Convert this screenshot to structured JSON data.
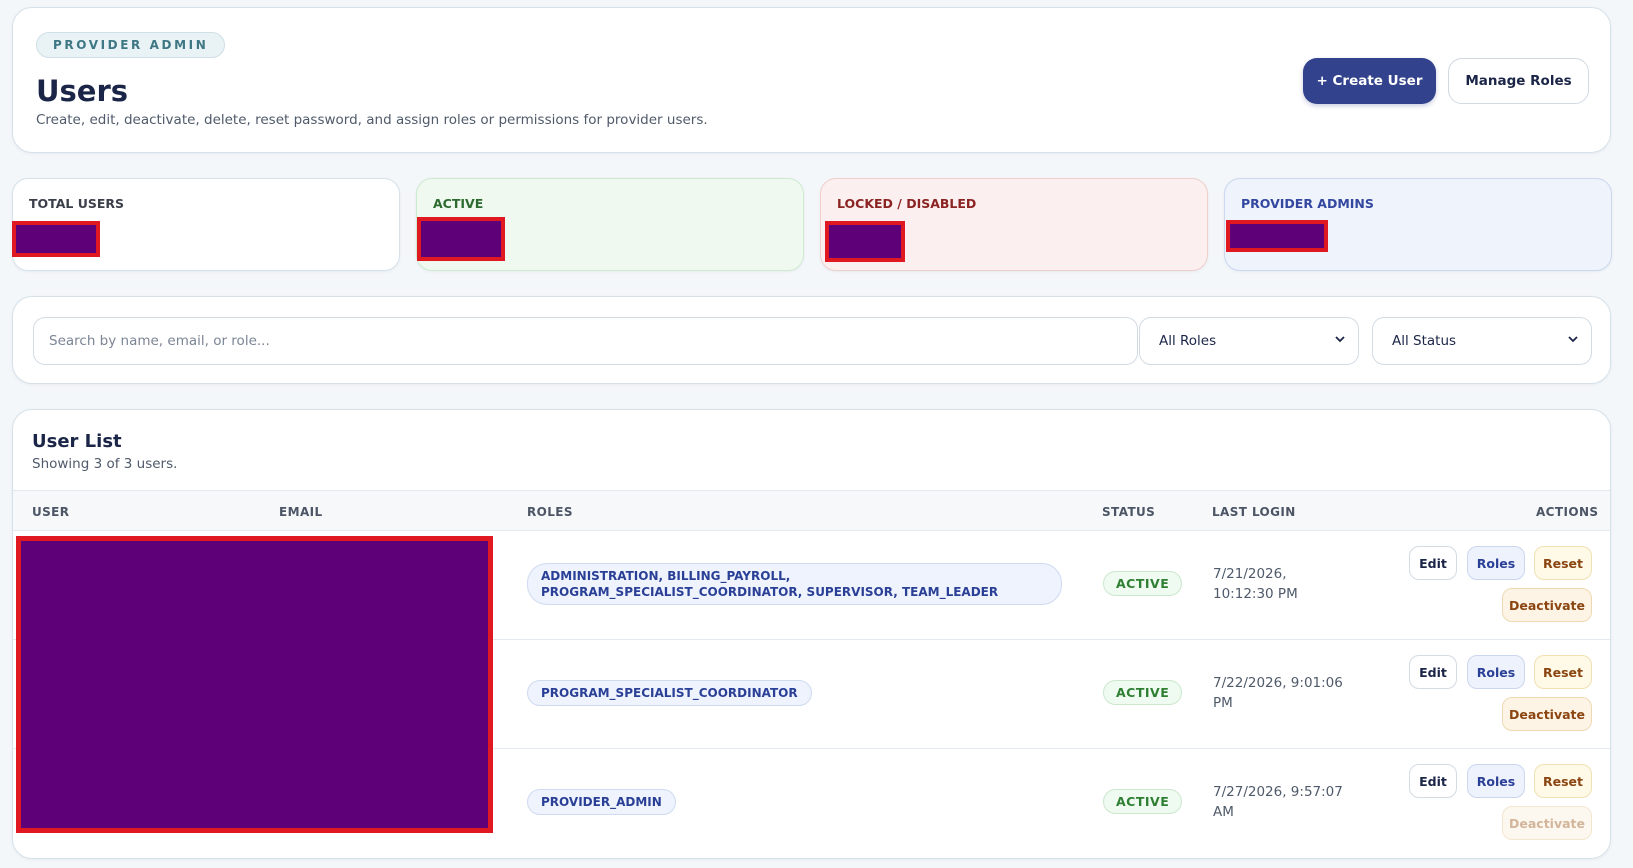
{
  "header": {
    "eyebrow": "PROVIDER ADMIN",
    "title": "Users",
    "subtitle": "Create, edit, deactivate, delete, reset password, and assign roles or permissions for provider users.",
    "create_label": "+ Create User",
    "manage_label": "Manage Roles"
  },
  "stats": [
    {
      "label": "TOTAL USERS",
      "color": "#3a3f4a"
    },
    {
      "label": "ACTIVE",
      "color": "#2c6a2f"
    },
    {
      "label": "LOCKED / DISABLED",
      "color": "#8b2323"
    },
    {
      "label": "PROVIDER ADMINS",
      "color": "#3347a0"
    }
  ],
  "filters": {
    "search_placeholder": "Search by name, email, or role...",
    "roles_value": "All Roles",
    "status_value": "All Status"
  },
  "list": {
    "title": "User List",
    "subtitle": "Showing 3 of 3 users.",
    "columns": [
      "USER",
      "EMAIL",
      "ROLES",
      "STATUS",
      "LAST LOGIN",
      "ACTIONS"
    ],
    "rows": [
      {
        "roles": "ADMINISTRATION, BILLING_PAYROLL, PROGRAM_SPECIALIST_COORDINATOR, SUPERVISOR, TEAM_LEADER",
        "status": "ACTIVE",
        "last_login": "7/21/2026, 10:12:30 PM",
        "deactivate_enabled": true
      },
      {
        "roles": "PROGRAM_SPECIALIST_COORDINATOR",
        "status": "ACTIVE",
        "last_login": "7/22/2026, 9:01:06 PM",
        "deactivate_enabled": true
      },
      {
        "roles": "PROVIDER_ADMIN",
        "status": "ACTIVE",
        "last_login": "7/27/2026, 9:57:07 AM",
        "deactivate_enabled": false
      }
    ],
    "actions": {
      "edit": "Edit",
      "roles": "Roles",
      "reset": "Reset",
      "deactivate": "Deactivate"
    }
  },
  "colors": {
    "primary": "#33428c",
    "redaction_fill": "#5e0077",
    "redaction_border": "#e01822"
  }
}
